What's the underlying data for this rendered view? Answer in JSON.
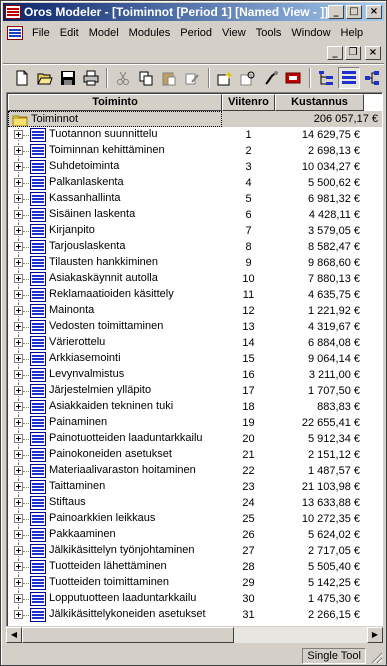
{
  "window": {
    "title": "Oros Modeler - [Toiminnot [Period 1] [Named View - ]]",
    "minimize_label": "_",
    "maximize_label": "□",
    "close_label": "×"
  },
  "menubar": {
    "items": [
      "File",
      "Edit",
      "Model",
      "Modules",
      "Period",
      "View",
      "Tools",
      "Window",
      "Help"
    ],
    "doc_minimize": "_",
    "doc_restore": "❐",
    "doc_close": "×"
  },
  "toolbar": {
    "buttons": [
      "new-icon",
      "open-icon",
      "save-icon",
      "print-icon",
      "cut-icon",
      "copy-icon",
      "paste-icon",
      "edit-icon",
      "new-item-icon",
      "find-icon",
      "properties-icon",
      "delete-icon",
      "tree-view-icon",
      "list-view-icon",
      "hierarchy-icon"
    ],
    "selected": "list-view-icon"
  },
  "grid": {
    "columns": [
      "Toiminto",
      "Viitenro",
      "Kustannus"
    ],
    "root": {
      "label": "Toiminnot",
      "cost": "206 057,17 €"
    },
    "rows": [
      {
        "name": "Tuotannon suunnittelu",
        "ref": "1",
        "cost": "14 629,75 €"
      },
      {
        "name": "Toiminnan kehittäminen",
        "ref": "2",
        "cost": "2 698,13 €"
      },
      {
        "name": "Suhdetoiminta",
        "ref": "3",
        "cost": "10 034,27 €"
      },
      {
        "name": "Palkanlaskenta",
        "ref": "4",
        "cost": "5 500,62 €"
      },
      {
        "name": "Kassanhallinta",
        "ref": "5",
        "cost": "6 981,32 €"
      },
      {
        "name": "Sisäinen laskenta",
        "ref": "6",
        "cost": "4 428,11 €"
      },
      {
        "name": "Kirjanpito",
        "ref": "7",
        "cost": "3 579,05 €"
      },
      {
        "name": "Tarjouslaskenta",
        "ref": "8",
        "cost": "8 582,47 €"
      },
      {
        "name": "Tilausten hankkiminen",
        "ref": "9",
        "cost": "9 868,60 €"
      },
      {
        "name": "Asiakaskäynnit autolla",
        "ref": "10",
        "cost": "7 880,13 €"
      },
      {
        "name": "Reklamaatioiden käsittely",
        "ref": "11",
        "cost": "4 635,75 €"
      },
      {
        "name": "Mainonta",
        "ref": "12",
        "cost": "1 221,92 €"
      },
      {
        "name": "Vedosten toimittaminen",
        "ref": "13",
        "cost": "4 319,67 €"
      },
      {
        "name": "Värierottelu",
        "ref": "14",
        "cost": "6 884,08 €"
      },
      {
        "name": "Arkkiasemointi",
        "ref": "15",
        "cost": "9 064,14 €"
      },
      {
        "name": "Levynvalmistus",
        "ref": "16",
        "cost": "3 211,00 €"
      },
      {
        "name": "Järjestelmien ylläpito",
        "ref": "17",
        "cost": "1 707,50 €"
      },
      {
        "name": "Asiakkaiden tekninen tuki",
        "ref": "18",
        "cost": "883,83 €"
      },
      {
        "name": "Painaminen",
        "ref": "19",
        "cost": "22 655,41 €"
      },
      {
        "name": "Painotuotteiden laaduntarkkailu",
        "ref": "20",
        "cost": "5 912,34 €"
      },
      {
        "name": "Painokoneiden asetukset",
        "ref": "21",
        "cost": "2 151,12 €"
      },
      {
        "name": "Materiaalivaraston hoitaminen",
        "ref": "22",
        "cost": "1 487,57 €"
      },
      {
        "name": "Taittaminen",
        "ref": "23",
        "cost": "21 103,98 €"
      },
      {
        "name": "Stiftaus",
        "ref": "24",
        "cost": "13 633,88 €"
      },
      {
        "name": "Painoarkkien leikkaus",
        "ref": "25",
        "cost": "10 272,35 €"
      },
      {
        "name": "Pakkaaminen",
        "ref": "26",
        "cost": "5 624,02 €"
      },
      {
        "name": "Jälkikäsittelyn työnjohtaminen",
        "ref": "27",
        "cost": "2 717,05 €"
      },
      {
        "name": "Tuotteiden lähettäminen",
        "ref": "28",
        "cost": "5 505,40 €"
      },
      {
        "name": "Tuotteiden toimittaminen",
        "ref": "29",
        "cost": "5 142,25 €"
      },
      {
        "name": "Lopputuotteen laaduntarkkailu",
        "ref": "30",
        "cost": "1 475,30 €"
      },
      {
        "name": "Jälkikäsittelykoneiden asetukset",
        "ref": "31",
        "cost": "2 266,15 €"
      }
    ]
  },
  "scrollbar": {
    "left_arrow": "◀",
    "right_arrow": "▶"
  },
  "statusbar": {
    "text": "Single Tool"
  }
}
